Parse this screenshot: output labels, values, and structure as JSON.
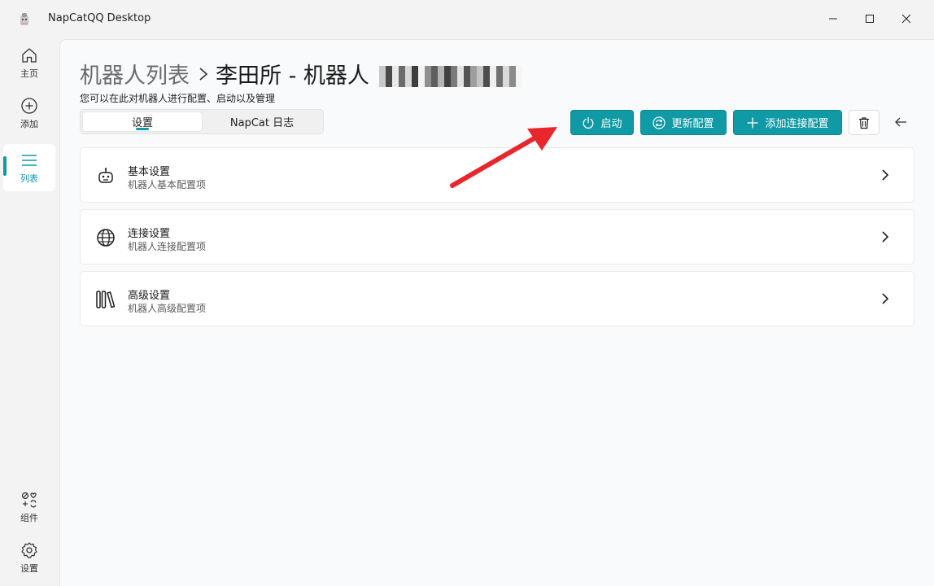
{
  "window": {
    "title": "NapCatQQ Desktop"
  },
  "sidebar": {
    "items": [
      {
        "label": "主页",
        "icon": "home-icon"
      },
      {
        "label": "添加",
        "icon": "add-circle-icon"
      },
      {
        "label": "列表",
        "icon": "list-icon",
        "active": true
      },
      {
        "label": "组件",
        "icon": "components-icon"
      },
      {
        "label": "设置",
        "icon": "gear-icon"
      }
    ]
  },
  "header": {
    "breadcrumb_parent": "机器人列表",
    "breadcrumb_current": "李田所 - 机器人",
    "subtitle": "您可以在此对机器人进行配置、启动以及管理"
  },
  "tabs": [
    {
      "label": "设置",
      "active": true
    },
    {
      "label": "NapCat 日志",
      "active": false
    }
  ],
  "toolbar": {
    "start_label": "启动",
    "update_label": "更新配置",
    "add_connection_label": "添加连接配置"
  },
  "cards": [
    {
      "title": "基本设置",
      "desc": "机器人基本配置项",
      "icon": "robot-icon"
    },
    {
      "title": "连接设置",
      "desc": "机器人连接配置项",
      "icon": "globe-icon"
    },
    {
      "title": "高级设置",
      "desc": "机器人高级配置项",
      "icon": "library-icon"
    }
  ],
  "colors": {
    "accent": "#0f9aa6",
    "annotation_arrow": "#e8262c"
  }
}
